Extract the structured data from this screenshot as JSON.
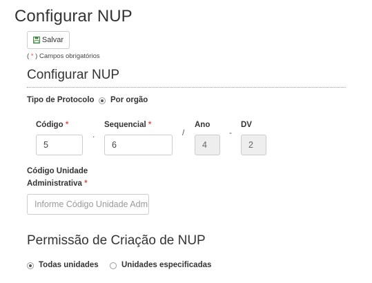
{
  "page": {
    "title": "Configurar NUP"
  },
  "toolbar": {
    "save_label": "Salvar"
  },
  "required_note": {
    "open": "( ",
    "star": "*",
    "close": " ) Campos obrigatórios"
  },
  "section1": {
    "title": "Configurar NUP",
    "tipo_label": "Tipo de Protocolo",
    "tipo_option": "Por orgão",
    "codigo": {
      "label": "Código",
      "value": "5"
    },
    "sequencial": {
      "label": "Sequencial",
      "value": "6"
    },
    "ano": {
      "label": "Ano",
      "value": "4"
    },
    "dv": {
      "label": "DV",
      "value": "2"
    },
    "separators": {
      "dot1": ".",
      "slash": "/",
      "dash": "-"
    },
    "unidade": {
      "label_line1": "Código Unidade",
      "label_line2": "Administrativa",
      "placeholder": "Informe Código Unidade Administrativa"
    },
    "required_star": "*"
  },
  "section2": {
    "title": "Permissão de Criação de NUP",
    "option_all": "Todas unidades",
    "option_specific": "Unidades especificadas"
  }
}
